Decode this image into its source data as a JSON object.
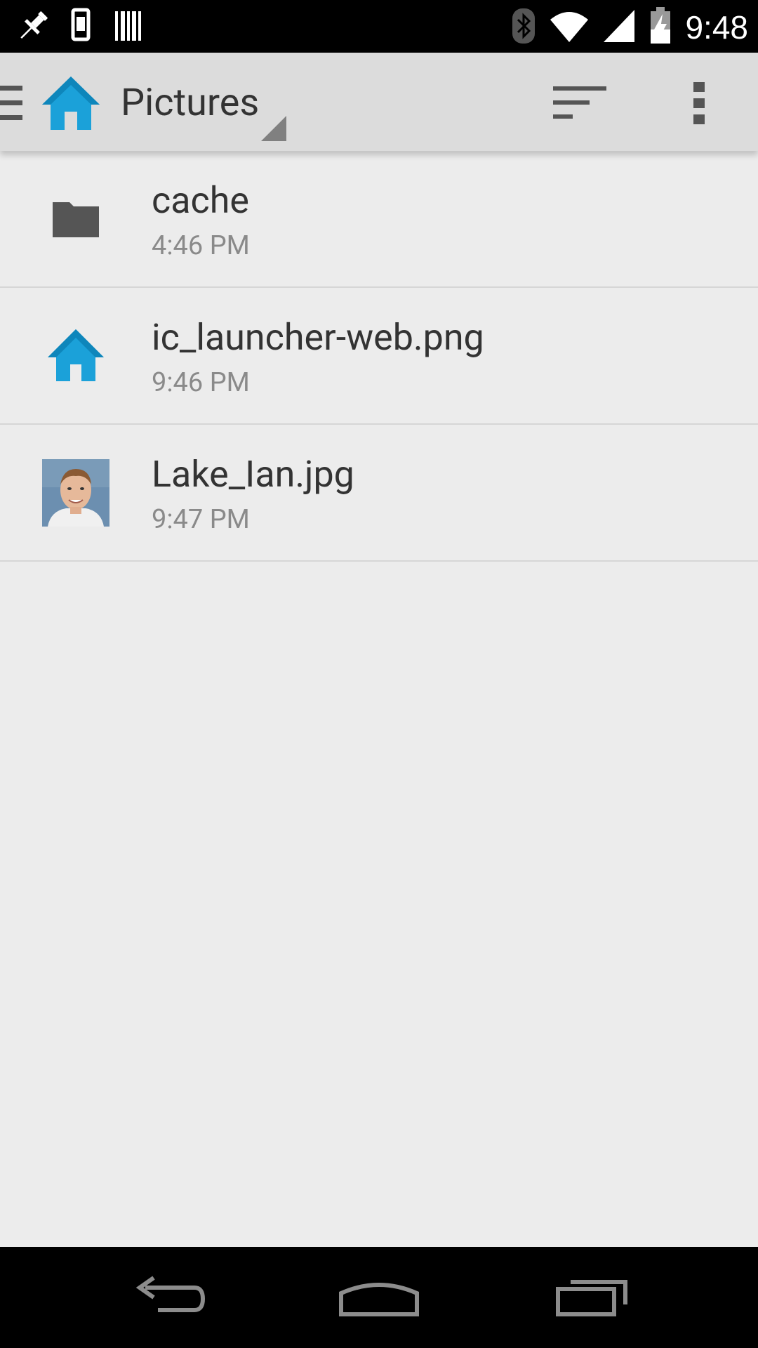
{
  "status_bar": {
    "time": "9:48",
    "icons": [
      "pushpin-icon",
      "phone-icon",
      "barcode-icon",
      "bluetooth-icon",
      "wifi-icon",
      "signal-icon",
      "battery-charging-icon"
    ]
  },
  "action_bar": {
    "title": "Pictures",
    "icons": [
      "drawer-icon",
      "home-icon",
      "sort-icon",
      "overflow-menu-icon"
    ]
  },
  "files": [
    {
      "name": "cache",
      "time": "4:46 PM",
      "icon": "folder-icon"
    },
    {
      "name": "ic_launcher-web.png",
      "time": "9:46 PM",
      "icon": "home-icon"
    },
    {
      "name": "Lake_Ian.jpg",
      "time": "9:47 PM",
      "icon": "photo-thumbnail"
    }
  ],
  "nav_bar": {
    "icons": [
      "back-icon",
      "home-nav-icon",
      "recents-icon"
    ]
  },
  "colors": {
    "accent": "#1ba1d9",
    "background": "#ececec",
    "action_bar": "#dcdcdc",
    "folder": "#555555"
  }
}
